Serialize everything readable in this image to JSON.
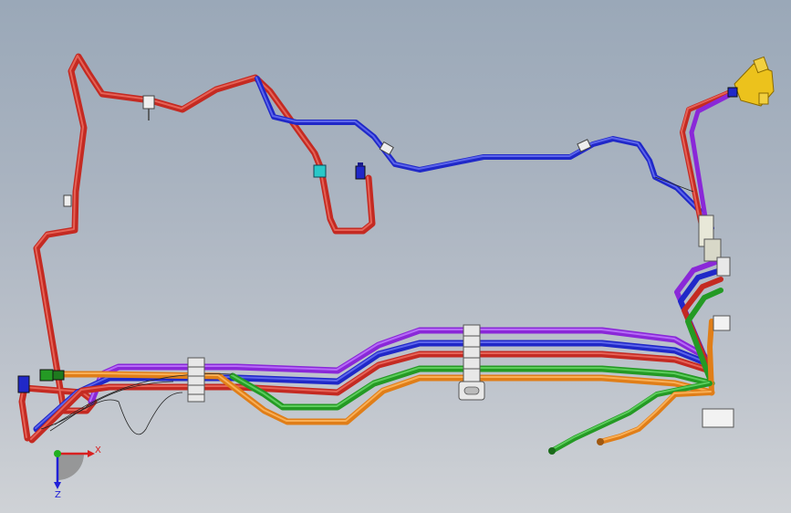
{
  "colors": {
    "red": "#c42a22",
    "red_hi": "#ee7064",
    "blue": "#2028c8",
    "blue_hi": "#6c74f4",
    "purple": "#8a28d8",
    "purple_hi": "#c07cff",
    "green": "#249a24",
    "green_hi": "#6ad86a",
    "orange": "#e07e18",
    "orange_hi": "#ffbb66",
    "yellow": "#ecc21c",
    "cyan": "#28c8c8",
    "clamp": "#e8e8e8",
    "axis_x": "#d82020",
    "axis_y": "#2020d8",
    "axis_origin": "#20b020"
  },
  "triad": {
    "x_label": "X",
    "z_label": "Z"
  }
}
